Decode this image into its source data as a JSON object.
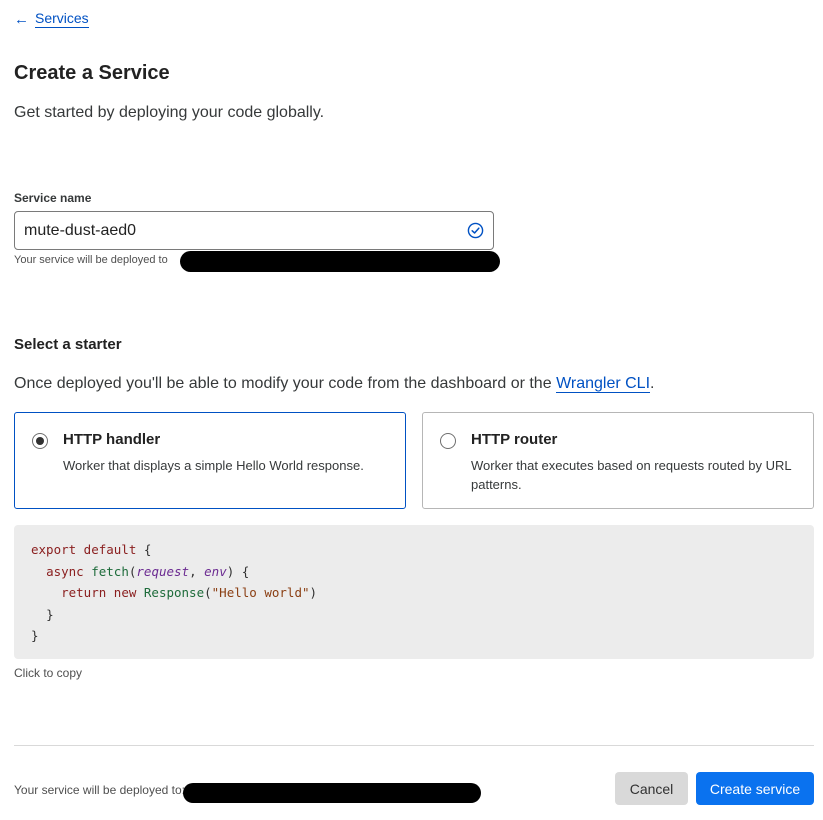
{
  "breadcrumb": {
    "arrow_icon": "arrow-left-icon",
    "label": "Services"
  },
  "page": {
    "title": "Create a Service",
    "subtitle": "Get started by deploying your code globally."
  },
  "service_name": {
    "label": "Service name",
    "value": "mute-dust-aed0",
    "valid_icon": "check-circle-icon",
    "hint": "Your service will be deployed to"
  },
  "starter": {
    "title": "Select a starter",
    "description": "Once deployed you'll be able to modify your code from the dashboard or the",
    "link_label": "Wrangler CLI",
    "description_end": ".",
    "options": [
      {
        "title": "HTTP handler",
        "description": "Worker that displays a simple Hello World response.",
        "selected": true
      },
      {
        "title": "HTTP router",
        "description": "Worker that executes based on requests routed by URL patterns.",
        "selected": false
      }
    ]
  },
  "code": {
    "line1_kw": "export default",
    "line1_rest": " {",
    "line2_kw": "async",
    "line2_fn": "fetch",
    "line2_open": "(",
    "line2_p1": "request",
    "line2_sep": ", ",
    "line2_p2": "env",
    "line2_close": ") {",
    "line3_kw": "return new",
    "line3_fn": "Response",
    "line3_open": "(",
    "line3_str": "\"Hello world\"",
    "line3_close": ")",
    "line4": "}",
    "line5": "}",
    "copy_hint": "Click to copy"
  },
  "footer": {
    "hint": "Your service will be deployed to:",
    "cancel_label": "Cancel",
    "create_label": "Create service"
  },
  "colors": {
    "link": "#0051c3",
    "primary_button": "#0a72ef",
    "selected_border": "#0051c3"
  }
}
